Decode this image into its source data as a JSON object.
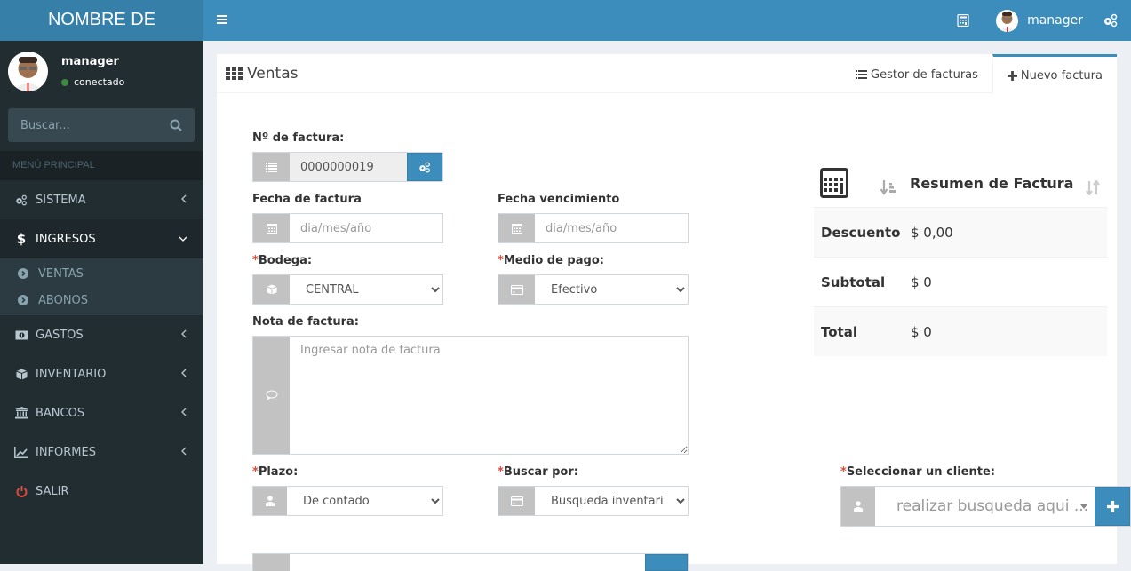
{
  "app": {
    "logo_text": "NOMBRE DE"
  },
  "topbar": {
    "user_name": "manager",
    "icons": [
      "menu-icon",
      "calculator-icon",
      "gears-icon"
    ]
  },
  "sidebar": {
    "user_name": "manager",
    "status": "conectado",
    "status_color": "#3c8a3c",
    "search_placeholder": "Buscar...",
    "header": "MENÚ PRINCIPAL",
    "items": [
      {
        "label": "SISTEMA",
        "icon": "gears-icon",
        "expanded": false
      },
      {
        "label": "INGRESOS",
        "icon": "dollar-icon",
        "expanded": true,
        "children": [
          {
            "label": "VENTAS"
          },
          {
            "label": "ABONOS"
          }
        ]
      },
      {
        "label": "GASTOS",
        "icon": "money-icon",
        "expanded": false
      },
      {
        "label": "INVENTARIO",
        "icon": "cube-icon",
        "expanded": false
      },
      {
        "label": "BANCOS",
        "icon": "bank-icon",
        "expanded": false
      },
      {
        "label": "INFORMES",
        "icon": "line-chart-icon",
        "expanded": false
      },
      {
        "label": "SALIR",
        "icon": "power-icon",
        "color": "#dd4b39"
      }
    ]
  },
  "page": {
    "title": "Ventas",
    "tabs": [
      {
        "label": "Gestor de facturas",
        "icon": "list-icon",
        "active": false
      },
      {
        "label": "Nuevo factura",
        "icon": "plus-icon",
        "active": true
      }
    ]
  },
  "form": {
    "invoice_number_label": "Nº de factura:",
    "invoice_number_value": "0000000019",
    "invoice_date_label": "Fecha de factura",
    "invoice_date_placeholder": "dia/mes/año",
    "due_date_label": "Fecha vencimiento",
    "due_date_placeholder": "dia/mes/año",
    "warehouse_label": "Bodega:",
    "warehouse_value": "CENTRAL",
    "payment_label": "Medio de pago:",
    "payment_value": "Efectivo",
    "note_label": "Nota de factura:",
    "note_placeholder": "Ingresar nota de factura",
    "term_label": "Plazo:",
    "term_value": "De contado",
    "search_by_label": "Buscar por:",
    "search_by_value": "Busqueda inventario",
    "client_label": "Seleccionar un cliente:",
    "client_placeholder": "realizar busqueda aqui ...",
    "required_mark": "*"
  },
  "summary": {
    "title": "Resumen de Factura",
    "rows": [
      {
        "label": "Descuento",
        "value": "$ 0,00"
      },
      {
        "label": "Subtotal",
        "value": "$ 0"
      },
      {
        "label": "Total",
        "value": "$ 0"
      }
    ]
  },
  "colors": {
    "primary": "#3c8dbc",
    "primary_dark": "#367fa9",
    "sidebar": "#222d32",
    "danger": "#dd4b39"
  }
}
